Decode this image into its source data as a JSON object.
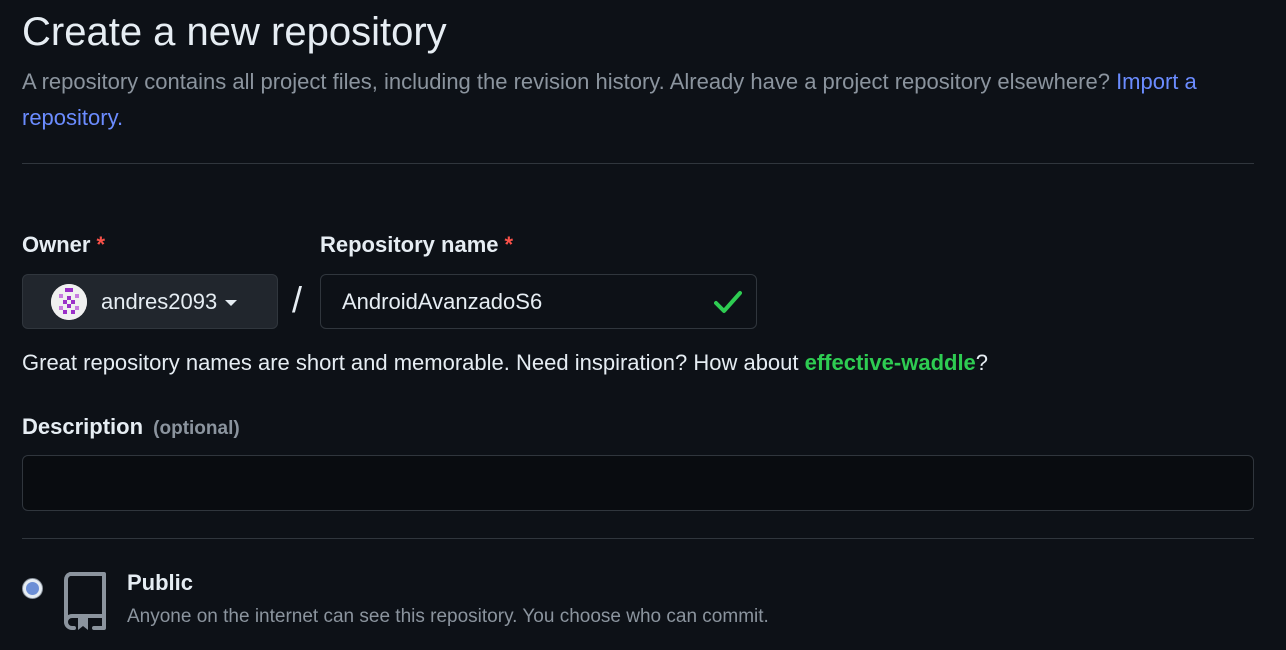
{
  "header": {
    "title": "Create a new repository",
    "subtitle": "A repository contains all project files, including the revision history. Already have a project repository elsewhere?",
    "import_link": "Import a repository."
  },
  "owner": {
    "label": "Owner",
    "required_mark": "*",
    "value": "andres2093",
    "separator": "/"
  },
  "repository_name": {
    "label": "Repository name",
    "required_mark": "*",
    "value": "AndroidAvanzadoS6",
    "valid": true
  },
  "name_hint": {
    "prefix": "Great repository names are short and memorable. Need inspiration? How about ",
    "suggestion": "effective-waddle",
    "suffix": "?"
  },
  "description": {
    "label": "Description",
    "optional": "(optional)",
    "value": ""
  },
  "visibility": {
    "selected": "Public",
    "options": [
      {
        "label": "Public",
        "description": "Anyone on the internet can see this repository. You choose who can commit.",
        "icon": "repo-icon"
      }
    ]
  },
  "colors": {
    "background": "#0d1117",
    "text": "#e6edf3",
    "muted": "#8b949e",
    "link": "#6b8cff",
    "required": "#f85149",
    "success": "#2ecc52",
    "border": "#30363d"
  }
}
